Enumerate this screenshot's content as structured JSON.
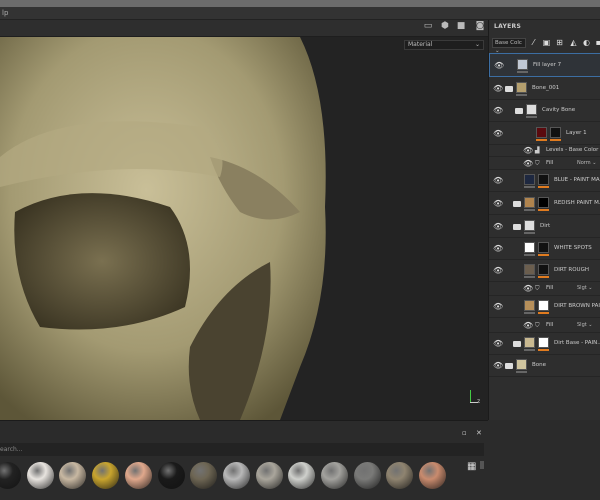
{
  "menubar": {
    "partial_label": "lp"
  },
  "viewport": {
    "display_mode": "Material",
    "axis_label": "z",
    "toolbar_icons": [
      "camera-frame-icon",
      "object-icon",
      "video-icon",
      "screenshot-icon"
    ]
  },
  "layers": {
    "title": "LAYERS",
    "channel": "Base Colc",
    "tools": [
      "brush-icon",
      "add-layer-icon",
      "add-fill-icon",
      "add-mask-icon",
      "add-effect-icon",
      "folder-icon"
    ],
    "rows": [
      {
        "name": "Fill layer 7",
        "selected": true
      },
      {
        "name": "Bone_001",
        "folder": true
      },
      {
        "name": "Cavity Bone",
        "folder": true
      },
      {
        "name": "Layer 1"
      },
      {
        "name": "Levels - Base Color",
        "effect": true
      },
      {
        "name": "Fill",
        "effect": true,
        "blend": "Norm"
      },
      {
        "name": "BLUE - PAINT MASK"
      },
      {
        "name": "REDISH PAINT M...",
        "folder": true
      },
      {
        "name": "Dirt",
        "folder": true
      },
      {
        "name": "WHITE SPOTS"
      },
      {
        "name": "DIRT ROUGH"
      },
      {
        "name": "Fill",
        "effect": true,
        "blend": "Slgt"
      },
      {
        "name": "DIRT BROWN PAINT ..."
      },
      {
        "name": "Fill",
        "effect": true,
        "blend": "Slgt"
      },
      {
        "name": "Dirt Base - PAIN...",
        "folder": true
      },
      {
        "name": "Bone",
        "folder": true
      }
    ]
  },
  "shelf": {
    "search_placeholder": "earch...",
    "materials": [
      "#222",
      "#e8e4df",
      "#c8b8a2",
      "#c9a52e",
      "#e0a88c",
      "#1a1a1a",
      "#6e6654",
      "#b8b8b8",
      "#aaa69c",
      "#cfd0cc",
      "#a3a29e",
      "#7a7a78",
      "#8f8470",
      "#c98b6e"
    ]
  }
}
